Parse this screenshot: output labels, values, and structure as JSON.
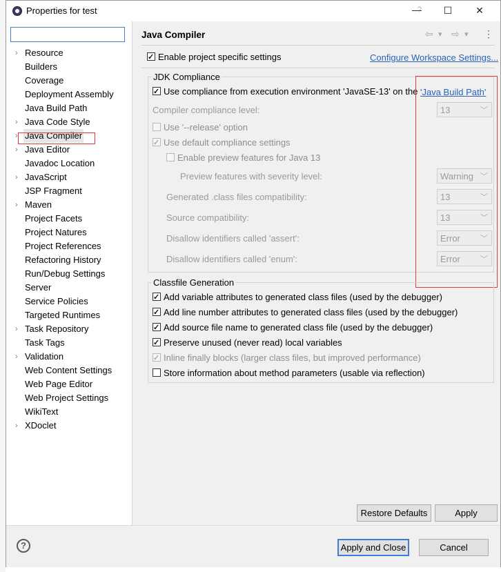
{
  "window": {
    "title": "Properties for test",
    "help": "?",
    "minimize": "—",
    "maximize": "☐",
    "close": "✕"
  },
  "sidebar": {
    "filter_value": "",
    "items": [
      {
        "label": "Resource",
        "expandable": true
      },
      {
        "label": "Builders",
        "expandable": false
      },
      {
        "label": "Coverage",
        "expandable": false
      },
      {
        "label": "Deployment Assembly",
        "expandable": false
      },
      {
        "label": "Java Build Path",
        "expandable": false
      },
      {
        "label": "Java Code Style",
        "expandable": true
      },
      {
        "label": "Java Compiler",
        "expandable": true,
        "selected": true
      },
      {
        "label": "Java Editor",
        "expandable": true
      },
      {
        "label": "Javadoc Location",
        "expandable": false
      },
      {
        "label": "JavaScript",
        "expandable": true
      },
      {
        "label": "JSP Fragment",
        "expandable": false
      },
      {
        "label": "Maven",
        "expandable": true
      },
      {
        "label": "Project Facets",
        "expandable": false
      },
      {
        "label": "Project Natures",
        "expandable": false
      },
      {
        "label": "Project References",
        "expandable": false
      },
      {
        "label": "Refactoring History",
        "expandable": false
      },
      {
        "label": "Run/Debug Settings",
        "expandable": false
      },
      {
        "label": "Server",
        "expandable": false
      },
      {
        "label": "Service Policies",
        "expandable": false
      },
      {
        "label": "Targeted Runtimes",
        "expandable": false
      },
      {
        "label": "Task Repository",
        "expandable": true
      },
      {
        "label": "Task Tags",
        "expandable": false
      },
      {
        "label": "Validation",
        "expandable": true
      },
      {
        "label": "Web Content Settings",
        "expandable": false
      },
      {
        "label": "Web Page Editor",
        "expandable": false
      },
      {
        "label": "Web Project Settings",
        "expandable": false
      },
      {
        "label": "WikiText",
        "expandable": false
      },
      {
        "label": "XDoclet",
        "expandable": true
      }
    ]
  },
  "main": {
    "title": "Java Compiler",
    "nav": {
      "back": "⇦",
      "back_menu": "▾",
      "forward": "⇨",
      "forward_menu": "▾",
      "more": "⋮"
    },
    "enable_project_specific": {
      "label": "Enable project specific settings",
      "checked": true
    },
    "configure_link": "Configure Workspace Settings...",
    "jdk": {
      "group_title": "JDK Compliance",
      "use_compliance": {
        "label": "Use compliance from execution environment 'JavaSE-13' on the ",
        "checked": true
      },
      "build_path_link": "'Java Build Path'",
      "compliance_level_label": "Compiler compliance level:",
      "compliance_level_value": "13",
      "use_release": {
        "label": "Use '--release' option",
        "checked": false
      },
      "use_default": {
        "label": "Use default compliance settings",
        "checked": true
      },
      "enable_preview": {
        "label": "Enable preview features for Java 13",
        "checked": false
      },
      "preview_severity_label": "Preview features with severity level:",
      "preview_severity_value": "Warning",
      "generated_label": "Generated .class files compatibility:",
      "generated_value": "13",
      "source_label": "Source compatibility:",
      "source_value": "13",
      "assert_label": "Disallow identifiers called 'assert':",
      "assert_value": "Error",
      "enum_label": "Disallow identifiers called 'enum':",
      "enum_value": "Error"
    },
    "classfile": {
      "group_title": "Classfile Generation",
      "variable_attrs": {
        "label": "Add variable attributes to generated class files (used by the debugger)",
        "checked": true
      },
      "line_number_attrs": {
        "label": "Add line number attributes to generated class files (used by the debugger)",
        "checked": true
      },
      "source_file_name": {
        "label": "Add source file name to generated class file (used by the debugger)",
        "checked": true
      },
      "preserve_unused": {
        "label": "Preserve unused (never read) local variables",
        "checked": true
      },
      "inline_finally": {
        "label": "Inline finally blocks (larger class files, but improved performance)",
        "checked": true
      },
      "store_params": {
        "label": "Store information about method parameters (usable via reflection)",
        "checked": false
      }
    },
    "restore_defaults": "Restore Defaults",
    "apply": "Apply"
  },
  "footer": {
    "help_icon": "?",
    "apply_close": "Apply and Close",
    "cancel": "Cancel"
  },
  "colors": {
    "accent": "#3c7fd2",
    "annotation_red": "#e23a3a",
    "link": "#2a62b8"
  }
}
